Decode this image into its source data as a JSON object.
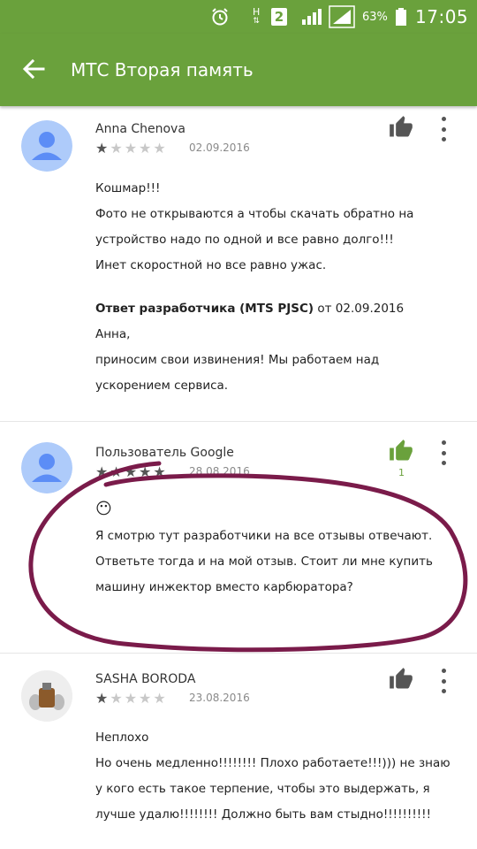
{
  "status_bar": {
    "network": "H",
    "sim": "2",
    "battery_percent": "63%",
    "time": "17:05"
  },
  "appbar": {
    "title": "МТС Вторая память"
  },
  "reviews": [
    {
      "author": "Anna Chenova",
      "rating": 1,
      "date": "02.09.2016",
      "text": "Кошмар!!!\nФото не открываются а чтобы скачать обратно на устройство надо по одной и все равно долго!!!\nИнет скоростной но все равно ужас.",
      "developer_reply": {
        "label": "Ответ разработчика (MTS PJSC)",
        "date_prefix": "от 02.09.2016",
        "text": "Анна,\nприносим свои извинения! Мы работаем над ускорением сервиса."
      }
    },
    {
      "author": "Пользователь Google",
      "rating": 5,
      "date": "28.08.2016",
      "likes": "1",
      "emoji": "😶",
      "text": "Я смотрю тут разработчики на все отзывы отвечают. Ответьте тогда и на мой отзыв. Стоит ли мне купить машину инжектор вместо карбюратора?"
    },
    {
      "author": "SASHA BORODA",
      "rating": 1,
      "date": "23.08.2016",
      "text": "Неплохо\nНо очень медленно!!!!!!!! Плохо работаете!!!))) не знаю у кого есть такое терпение, чтобы это выдержать, я лучше удалю!!!!!!!! Должно быть вам стыдно!!!!!!!!!!"
    }
  ],
  "colors": {
    "appbar": "#6aa13c",
    "like_active": "#6aa13c",
    "scribble": "#7a1b4a"
  }
}
